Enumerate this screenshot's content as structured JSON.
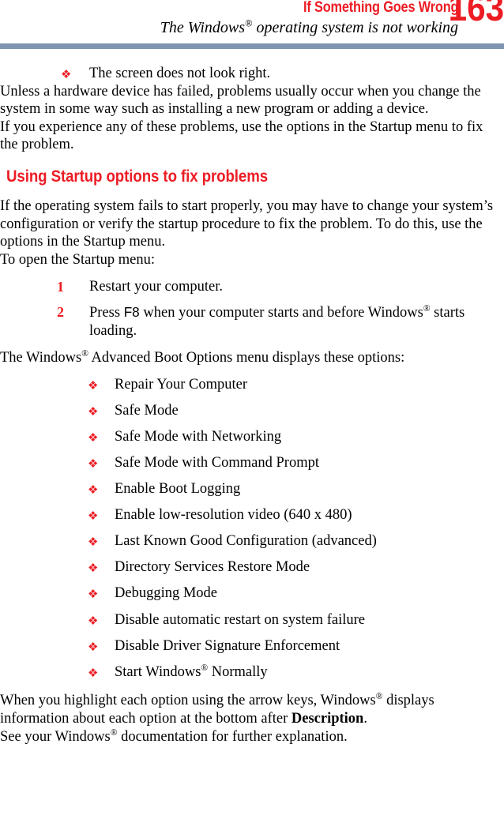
{
  "header": {
    "running_head": "If Something Goes Wrong",
    "page_number": "163",
    "running_subtitle_pre": "The Windows",
    "running_subtitle_reg": "®",
    "running_subtitle_post": " operating system is not working",
    "rule_color": "#7D95B0",
    "accent_color": "#ED1C24"
  },
  "bullet_glyph": "❖",
  "intro": {
    "symptom_bullet": "The screen does not look right.",
    "para_1": "Unless a hardware device has failed, problems usually occur when you change the system in some way such as installing a new program or adding a device.",
    "para_2": "If you experience any of these problems, use the options in the Startup menu to fix the problem."
  },
  "section": {
    "heading": "Using Startup options to fix problems",
    "para_1": "If the operating system fails to start properly, you may have to change your system’s configuration or verify the startup procedure to fix the problem. To do this, use the options in the Startup menu.",
    "para_2": "To open the Startup menu:"
  },
  "steps": [
    {
      "number": "1",
      "text": "Restart your computer."
    },
    {
      "number": "2",
      "text_pre": "Press ",
      "key": "F8",
      "text_mid": " when your computer starts and before Windows",
      "reg": "®",
      "text_post": " starts loading."
    }
  ],
  "menu_intro": {
    "pre": "The Windows",
    "reg": "®",
    "post": " Advanced Boot Options menu displays these options:"
  },
  "menu_options": [
    {
      "label": "Repair Your Computer"
    },
    {
      "label": "Safe Mode"
    },
    {
      "label": "Safe Mode with Networking"
    },
    {
      "label": "Safe Mode with Command Prompt"
    },
    {
      "label": "Enable Boot Logging"
    },
    {
      "label": "Enable low-resolution video (640 x 480)"
    },
    {
      "label": "Last Known Good Configuration (advanced)"
    },
    {
      "label": "Directory Services Restore Mode"
    },
    {
      "label": "Debugging Mode"
    },
    {
      "label": "Disable automatic restart on system failure"
    },
    {
      "label": "Disable Driver Signature Enforcement"
    },
    {
      "label_pre": "Start Windows",
      "reg": "®",
      "label_post": " Normally"
    }
  ],
  "closing": {
    "para_1_pre": "When you highlight each option using the arrow keys, Windows",
    "para_1_reg": "®",
    "para_1_mid": " displays information about each option at the bottom after ",
    "para_1_bold": "Description",
    "para_1_post": ".",
    "para_2_pre": "See your Windows",
    "para_2_reg": "®",
    "para_2_post": " documentation for further explanation."
  }
}
